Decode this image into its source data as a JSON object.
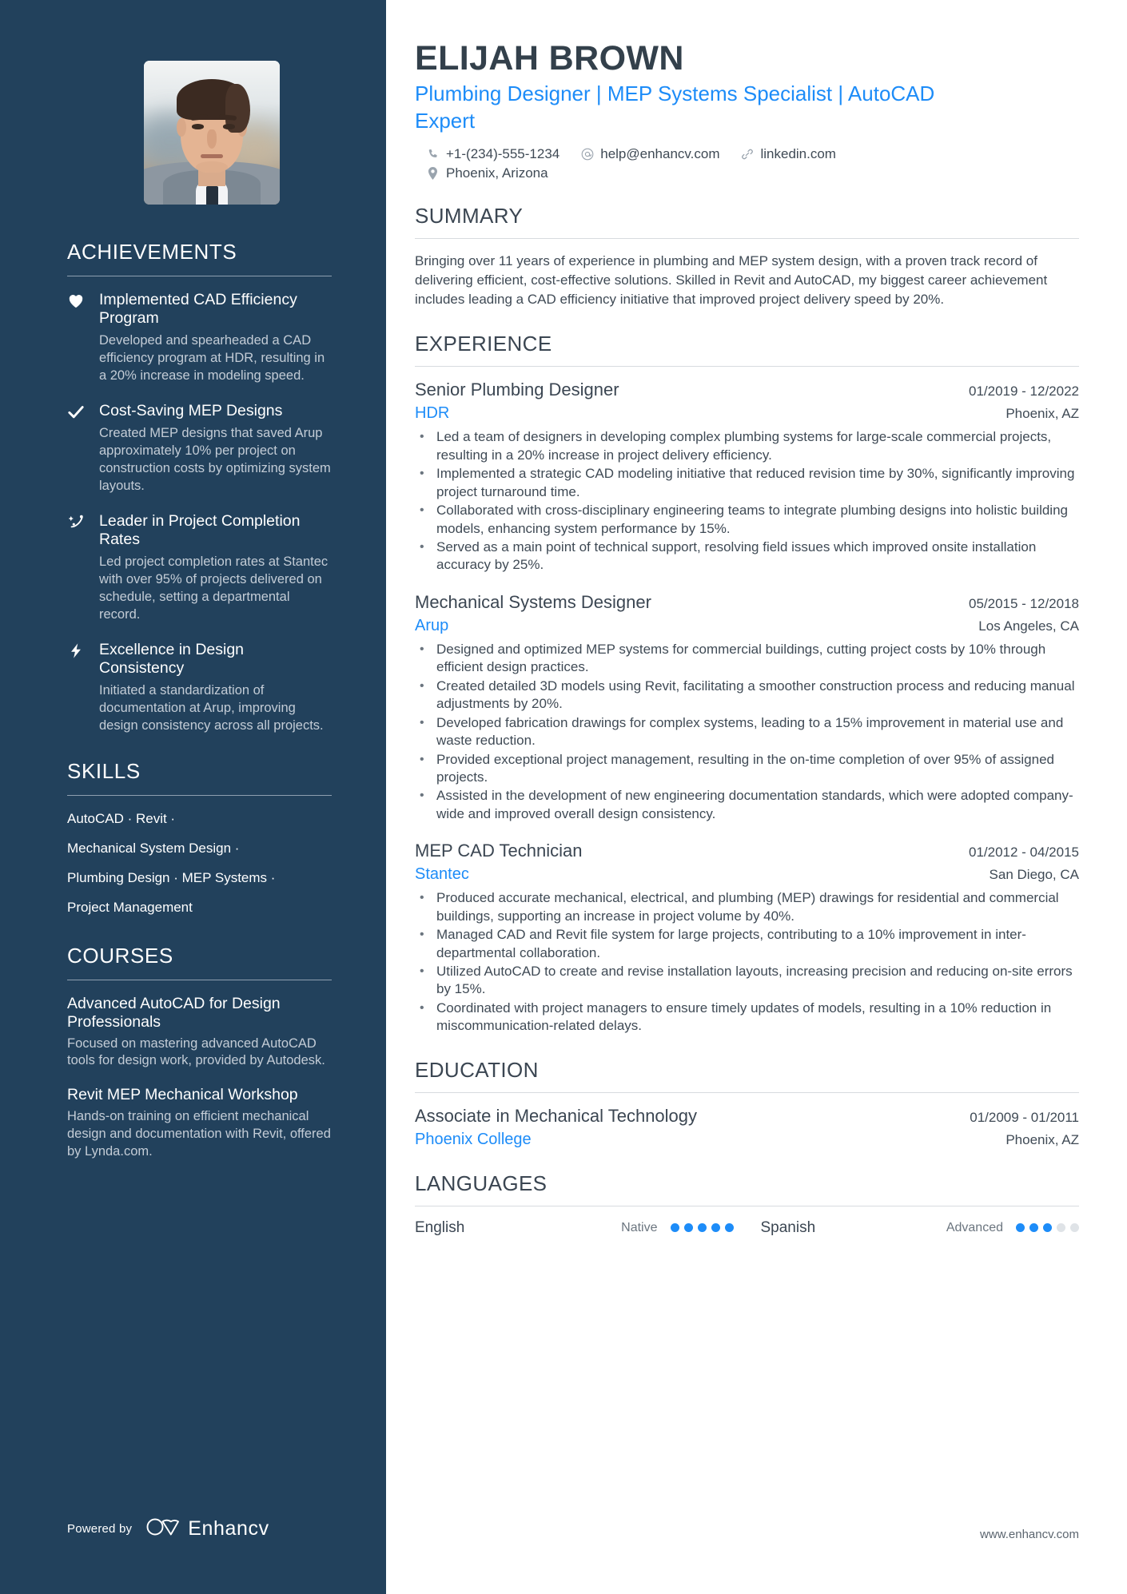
{
  "colors": {
    "sidebar_bg": "#22415c",
    "accent": "#1d8cf8",
    "heading": "#3b4652",
    "body": "#3f4a55",
    "muted": "#c3ccd6"
  },
  "header": {
    "name": "ELIJAH BROWN",
    "headline": "Plumbing Designer | MEP Systems Specialist | AutoCAD Expert",
    "contacts": [
      {
        "icon": "phone-icon",
        "text": "+1-(234)-555-1234"
      },
      {
        "icon": "email-icon",
        "text": "help@enhancv.com"
      },
      {
        "icon": "link-icon",
        "text": "linkedin.com"
      }
    ],
    "location": {
      "icon": "location-pin-icon",
      "text": "Phoenix, Arizona"
    }
  },
  "sidebar": {
    "achievements": {
      "heading": "ACHIEVEMENTS",
      "items": [
        {
          "icon": "heart-icon",
          "title": "Implemented CAD Efficiency Program",
          "desc": "Developed and spearheaded a CAD efficiency program at HDR, resulting in a 20% increase in modeling speed."
        },
        {
          "icon": "check-icon",
          "title": "Cost-Saving MEP Designs",
          "desc": "Created MEP designs that saved Arup approximately 10% per project on construction costs by optimizing system layouts."
        },
        {
          "icon": "rocket-icon",
          "title": "Leader in Project Completion Rates",
          "desc": "Led project completion rates at Stantec with over 95% of projects delivered on schedule, setting a departmental record."
        },
        {
          "icon": "lightning-icon",
          "title": "Excellence in Design Consistency",
          "desc": "Initiated a standardization of documentation at Arup, improving design consistency across all projects."
        }
      ]
    },
    "skills": {
      "heading": "SKILLS",
      "lines": [
        "AutoCAD · Revit ·",
        "Mechanical System Design ·",
        "Plumbing Design · MEP Systems ·",
        "Project Management"
      ]
    },
    "courses": {
      "heading": "COURSES",
      "items": [
        {
          "title": "Advanced AutoCAD for Design Professionals",
          "desc": "Focused on mastering advanced AutoCAD tools for design work, provided by Autodesk."
        },
        {
          "title": "Revit MEP Mechanical Workshop",
          "desc": "Hands-on training on efficient mechanical design and documentation with Revit, offered by Lynda.com."
        }
      ]
    },
    "footer": {
      "powered_by": "Powered by",
      "brand": "Enhancv",
      "logo_icon": "enhancv-infinity-icon"
    }
  },
  "main": {
    "summary": {
      "heading": "SUMMARY",
      "text": "Bringing over 11 years of experience in plumbing and MEP system design, with a proven track record of delivering efficient, cost-effective solutions. Skilled in Revit and AutoCAD, my biggest career achievement includes leading a CAD efficiency initiative that improved project delivery speed by 20%."
    },
    "experience": {
      "heading": "EXPERIENCE",
      "entries": [
        {
          "title": "Senior Plumbing Designer",
          "date": "01/2019 - 12/2022",
          "org": "HDR",
          "location": "Phoenix, AZ",
          "bullets": [
            "Led a team of designers in developing complex plumbing systems for large-scale commercial projects, resulting in a 20% increase in project delivery efficiency.",
            "Implemented a strategic CAD modeling initiative that reduced revision time by 30%, significantly improving project turnaround time.",
            "Collaborated with cross-disciplinary engineering teams to integrate plumbing designs into holistic building models, enhancing system performance by 15%.",
            "Served as a main point of technical support, resolving field issues which improved onsite installation accuracy by 25%."
          ]
        },
        {
          "title": "Mechanical Systems Designer",
          "date": "05/2015 - 12/2018",
          "org": "Arup",
          "location": "Los Angeles, CA",
          "bullets": [
            "Designed and optimized MEP systems for commercial buildings, cutting project costs by 10% through efficient design practices.",
            "Created detailed 3D models using Revit, facilitating a smoother construction process and reducing manual adjustments by 20%.",
            "Developed fabrication drawings for complex systems, leading to a 15% improvement in material use and waste reduction.",
            "Provided exceptional project management, resulting in the on-time completion of over 95% of assigned projects.",
            "Assisted in the development of new engineering documentation standards, which were adopted company-wide and improved overall design consistency."
          ]
        },
        {
          "title": "MEP CAD Technician",
          "date": "01/2012 - 04/2015",
          "org": "Stantec",
          "location": "San Diego, CA",
          "bullets": [
            "Produced accurate mechanical, electrical, and plumbing (MEP) drawings for residential and commercial buildings, supporting an increase in project volume by 40%.",
            "Managed CAD and Revit file system for large projects, contributing to a 10% improvement in inter-departmental collaboration.",
            "Utilized AutoCAD to create and revise installation layouts, increasing precision and reducing on-site errors by 15%.",
            "Coordinated with project managers to ensure timely updates of models, resulting in a 10% reduction in miscommunication-related delays."
          ]
        }
      ]
    },
    "education": {
      "heading": "EDUCATION",
      "entries": [
        {
          "title": "Associate in Mechanical Technology",
          "date": "01/2009 - 01/2011",
          "org": "Phoenix College",
          "location": "Phoenix, AZ"
        }
      ]
    },
    "languages": {
      "heading": "LANGUAGES",
      "items": [
        {
          "name": "English",
          "level": "Native",
          "filled": 5,
          "total": 5
        },
        {
          "name": "Spanish",
          "level": "Advanced",
          "filled": 3,
          "total": 5
        }
      ]
    },
    "footer": {
      "website": "www.enhancv.com"
    }
  }
}
